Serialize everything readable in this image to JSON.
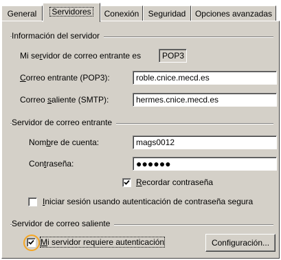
{
  "tabs": [
    {
      "label": "General",
      "active": false
    },
    {
      "label": "Servidores",
      "active": true
    },
    {
      "label": "Conexión",
      "active": false
    },
    {
      "label": "Seguridad",
      "active": false
    },
    {
      "label": "Opciones avanzadas",
      "active": false
    }
  ],
  "server_info": {
    "group_title": "Información del servidor",
    "incoming_type_label_pre": "Mi se",
    "incoming_type_label_acc": "r",
    "incoming_type_label_post": "vidor de correo entrante es",
    "incoming_type_value": "POP3",
    "incoming_label_pre": "",
    "incoming_label_acc": "C",
    "incoming_label_post": "orreo entrante (POP3):",
    "incoming_value": "roble.cnice.mecd.es",
    "outgoing_label_pre": "Correo ",
    "outgoing_label_acc": "s",
    "outgoing_label_post": "aliente (SMTP):",
    "outgoing_value": "hermes.cnice.mecd.es"
  },
  "incoming_server": {
    "group_title": "Servidor de correo entrante",
    "account_label_pre": "Nom",
    "account_label_acc": "b",
    "account_label_post": "re de cuenta:",
    "account_value": "mags0012",
    "password_label_pre": "Con",
    "password_label_acc": "t",
    "password_label_post": "raseña:",
    "password_value": "●●●●●●",
    "remember_label_pre": "",
    "remember_label_acc": "R",
    "remember_label_post": "ecordar contraseña",
    "remember_checked": true,
    "spa_label_pre": "",
    "spa_label_acc": "I",
    "spa_label_post": "niciar sesión usando autenticación de contraseña segura",
    "spa_checked": false
  },
  "outgoing_server": {
    "group_title": "Servidor de correo saliente",
    "auth_label_pre": "",
    "auth_label_acc": "M",
    "auth_label_post": "i servidor requiere autenticación",
    "auth_checked": true,
    "settings_label_pre": "Confi",
    "settings_label_acc": "g",
    "settings_label_post": "uración..."
  },
  "colors": {
    "dialog_bg": "#d4d0c8",
    "highlight_ring": "#f5a623"
  }
}
